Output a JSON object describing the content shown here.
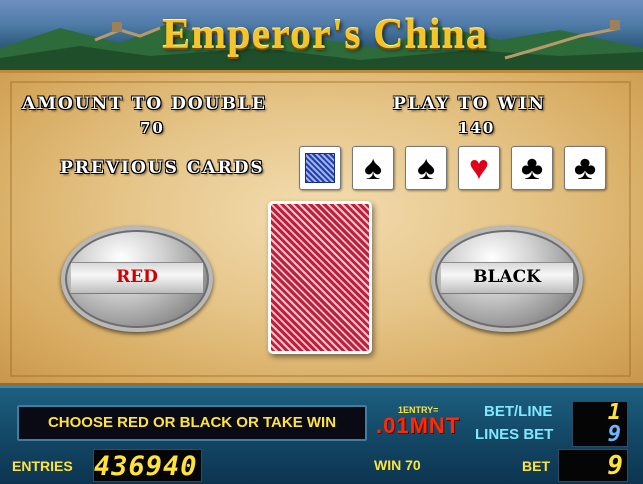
{
  "header": {
    "title": "Emperor's China"
  },
  "gamble": {
    "amount_label": "AMOUNT TO DOUBLE",
    "amount_value": "70",
    "play_label": "PLAY TO WIN",
    "play_value": "140",
    "previous_label": "PREVIOUS CARDS",
    "previous_cards": [
      {
        "kind": "back",
        "glyph": ""
      },
      {
        "kind": "spade",
        "glyph": "♠"
      },
      {
        "kind": "spade",
        "glyph": "♠"
      },
      {
        "kind": "heart",
        "glyph": "♥"
      },
      {
        "kind": "club",
        "glyph": "♣"
      },
      {
        "kind": "club",
        "glyph": "♣"
      }
    ],
    "red_button": "RED",
    "black_button": "BLACK"
  },
  "console": {
    "message": "CHOOSE RED OR BLACK OR TAKE WIN",
    "entry_rate": "1ENTRY=",
    "denomination": ".01MNT",
    "bet_line_label": "BET/LINE",
    "lines_bet_label": "LINES BET",
    "bet_line_value": "1",
    "lines_bet_value": "9",
    "entries_label": "ENTRIES",
    "entries_value": "436940",
    "win_label": "WIN 70",
    "bet_label": "BET",
    "bet_value": "9"
  },
  "colors": {
    "title_gold": "#f3c52a",
    "panel_parchment": "#e5c487",
    "console_blue": "#134866",
    "digits_yellow": "#ffe33a",
    "red_button_text": "#d10000",
    "card_back_red": "#c01f3a"
  }
}
